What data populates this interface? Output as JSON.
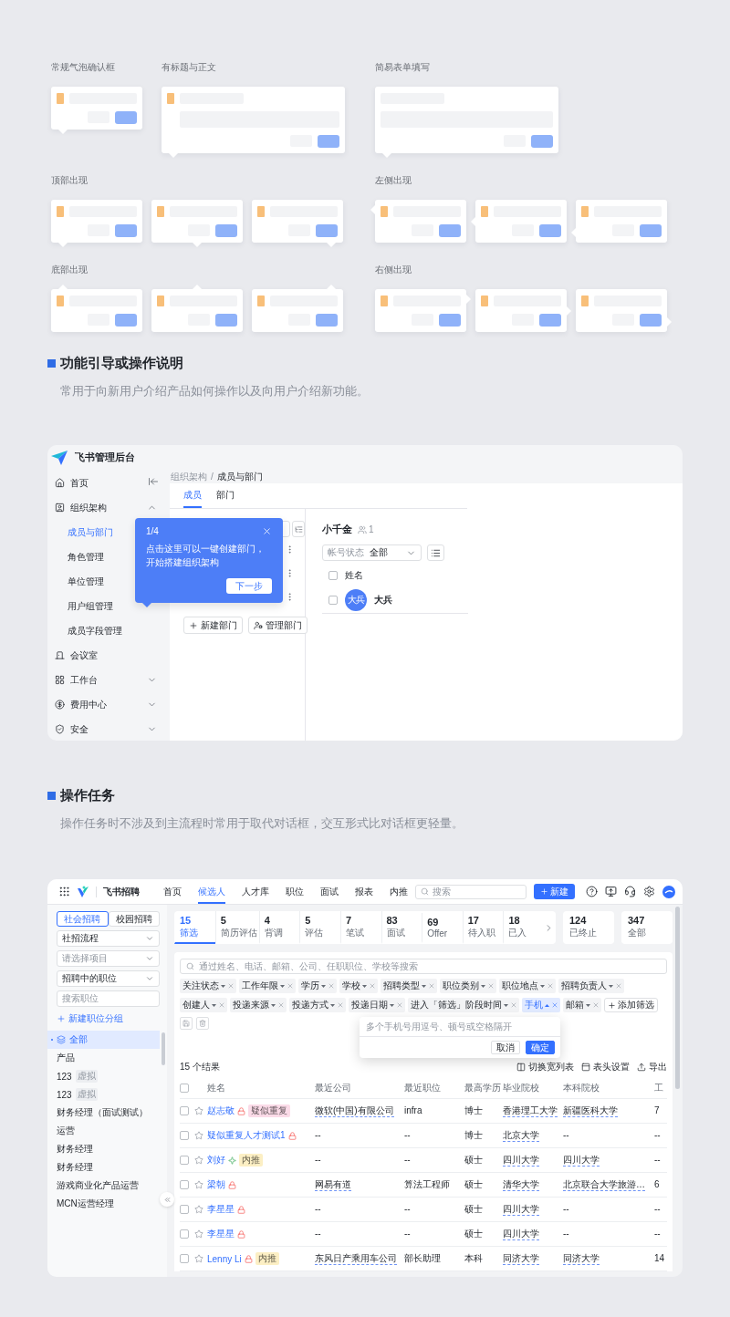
{
  "popover_demos": {
    "rows": [
      {
        "left": [
          {
            "label": "常规气泡确认框",
            "kind": "confirm",
            "cards": [
              {
                "kind": "bottom-start"
              }
            ]
          },
          {
            "label": "有标题与正文",
            "kind": "titled",
            "cards": [
              {
                "kind": "bottom-start"
              }
            ]
          }
        ],
        "right": [
          {
            "label": "简易表单填写",
            "kind": "form",
            "cards": [
              {
                "kind": "bottom-start"
              }
            ]
          }
        ]
      },
      {
        "left": [
          {
            "label": "顶部出现",
            "kind": "confirm",
            "cards": [
              {
                "kind": "bottom-start"
              },
              {
                "kind": "bottom-center"
              },
              {
                "kind": "bottom-end"
              }
            ]
          }
        ],
        "right": [
          {
            "label": "左侧出现",
            "kind": "confirm",
            "cards": [
              {
                "kind": "left-start"
              },
              {
                "kind": "left-center"
              },
              {
                "kind": "left-end"
              }
            ]
          }
        ]
      },
      {
        "left": [
          {
            "label": "底部出现",
            "kind": "confirm",
            "cards": [
              {
                "kind": "top-start"
              },
              {
                "kind": "top-center"
              },
              {
                "kind": "top-end"
              }
            ]
          }
        ],
        "right": [
          {
            "label": "右侧出现",
            "kind": "confirm",
            "cards": [
              {
                "kind": "right-start"
              },
              {
                "kind": "right-center"
              },
              {
                "kind": "right-end"
              }
            ]
          }
        ]
      }
    ]
  },
  "guide_section": {
    "title": "功能引导或操作说明",
    "description": "常用于向新用户介绍产品如何操作以及向用户介绍新功能。",
    "app": {
      "title": "飞书管理后台",
      "sidebar": [
        {
          "label": "首页",
          "selected": false
        },
        {
          "label": "组织架构",
          "selected": false,
          "expanded": true,
          "children": [
            {
              "label": "成员与部门",
              "selected": true
            },
            {
              "label": "角色管理",
              "selected": false
            },
            {
              "label": "单位管理",
              "selected": false
            },
            {
              "label": "用户组管理",
              "selected": false
            },
            {
              "label": "成员字段管理",
              "selected": false
            }
          ]
        },
        {
          "label": "会议室",
          "selected": false
        },
        {
          "label": "工作台",
          "selected": false,
          "expanded": false
        },
        {
          "label": "费用中心",
          "selected": false,
          "expanded": false
        },
        {
          "label": "安全",
          "selected": false,
          "expanded": false
        }
      ],
      "breadcrumb": [
        {
          "text": "组织架构",
          "kind": "link"
        },
        {
          "text": "/",
          "kind": "separator"
        },
        {
          "text": "成员与部门",
          "kind": "current"
        }
      ],
      "tabs": [
        {
          "label": "成员",
          "selected": true
        },
        {
          "label": "部门",
          "selected": false
        }
      ],
      "department_buttons": [
        "新建部门",
        "管理部门"
      ],
      "tour": {
        "step": "1/4",
        "text": "点击这里可以一键创建部门，开始搭建组织架构",
        "button": "下一步"
      },
      "members": {
        "title": "小千金",
        "count": "1",
        "filter": {
          "label": "帐号状态",
          "value": "全部"
        },
        "header": {
          "label": "姓名",
          "checked": false
        },
        "rows": [
          {
            "avatar": "大兵",
            "name": "大兵",
            "checked": false
          }
        ]
      }
    }
  },
  "task_section": {
    "title": "操作任务",
    "description": "操作任务时不涉及到主流程时常用于取代对话框，交互形式比对话框更轻量。",
    "app": {
      "brand": "飞书招聘",
      "nav": [
        {
          "label": "首页",
          "selected": false
        },
        {
          "label": "候选人",
          "selected": true
        },
        {
          "label": "人才库",
          "selected": false
        },
        {
          "label": "职位",
          "selected": false
        },
        {
          "label": "面试",
          "selected": false
        },
        {
          "label": "报表",
          "selected": false
        },
        {
          "label": "内推",
          "selected": false
        }
      ],
      "search_placeholder": "搜索",
      "new_button": "新建",
      "sidebar": {
        "segments": [
          {
            "label": "社会招聘",
            "selected": true
          },
          {
            "label": "校园招聘",
            "selected": false
          }
        ],
        "selects": [
          {
            "text": "社招流程",
            "kind": "value"
          },
          {
            "text": "请选择项目",
            "kind": "placeholder"
          },
          {
            "text": "招聘中的职位",
            "kind": "value"
          }
        ],
        "search_placeholder": "搜索职位",
        "add_group": "新建职位分组",
        "tree": [
          {
            "label": "全部",
            "selected": true
          },
          {
            "label": "产品",
            "selected": false
          },
          {
            "label": "123",
            "tag": "虚拟",
            "selected": false
          },
          {
            "label": "123",
            "tag": "虚拟",
            "selected": false
          },
          {
            "label": "财务经理（面试测试）",
            "selected": false
          },
          {
            "label": "运营",
            "selected": false
          },
          {
            "label": "财务经理",
            "selected": false
          },
          {
            "label": "财务经理",
            "selected": false
          },
          {
            "label": "游戏商业化产品运营",
            "selected": false
          },
          {
            "label": "MCN运营经理",
            "selected": false
          }
        ]
      },
      "stages": [
        {
          "count": "15",
          "label": "筛选",
          "selected": true
        },
        {
          "count": "5",
          "label": "简历评估",
          "selected": false
        },
        {
          "count": "4",
          "label": "背调",
          "selected": false
        },
        {
          "count": "5",
          "label": "评估",
          "selected": false
        },
        {
          "count": "7",
          "label": "笔试",
          "selected": false
        },
        {
          "count": "83",
          "label": "面试",
          "selected": false
        },
        {
          "count": "69",
          "label": "Offer",
          "selected": false
        },
        {
          "count": "17",
          "label": "待入职",
          "selected": false
        },
        {
          "count": "18",
          "label": "已入",
          "selected": false
        }
      ],
      "summary": [
        {
          "count": "124",
          "label": "已终止"
        },
        {
          "count": "347",
          "label": "全部"
        }
      ],
      "filter_search_placeholder": "通过姓名、电话、邮箱、公司、任职职位、学校等搜索",
      "chip_rows": [
        {
          "chips": [
            {
              "label": "关注状态",
              "active": false
            },
            {
              "label": "工作年限",
              "active": false
            },
            {
              "label": "学历",
              "active": false
            },
            {
              "label": "学校",
              "active": false
            },
            {
              "label": "招聘类型",
              "active": false
            },
            {
              "label": "职位类别",
              "active": false
            },
            {
              "label": "职位地点",
              "active": false
            },
            {
              "label": "招聘负责人",
              "active": false
            }
          ]
        },
        {
          "chips": [
            {
              "label": "创建人",
              "active": false
            },
            {
              "label": "投递来源",
              "active": false
            },
            {
              "label": "投递方式",
              "active": false
            },
            {
              "label": "投递日期",
              "active": false
            },
            {
              "label": "进入「筛选」阶段时间",
              "active": false
            },
            {
              "label": "手机",
              "active": true
            },
            {
              "label": "邮箱",
              "active": false
            }
          ],
          "add_button": "添加筛选"
        }
      ],
      "phone_popover": {
        "placeholder": "多个手机号用逗号、顿号或空格隔开",
        "cancel": "取消",
        "confirm": "确定"
      },
      "results": "15 个结果",
      "toolbar": [
        "切换宽列表",
        "表头设置",
        "导出"
      ],
      "table": {
        "header_checked": false,
        "name_header": "姓名",
        "columns": [
          "最近公司",
          "最近职位",
          "最高学历",
          "毕业院校",
          "本科院校",
          "工"
        ],
        "rows": [
          {
            "checked": false,
            "starred": false,
            "name": "赵志敬",
            "locked": true,
            "referred": false,
            "tag": {
              "text": "疑似重复",
              "color": "#fbdbe8"
            },
            "cells": [
              {
                "text": "微软(中国)有限公司",
                "link": true
              },
              {
                "text": "infra",
                "link": false
              },
              {
                "text": "博士",
                "link": false
              },
              {
                "text": "香港理工大学",
                "link": true
              },
              {
                "text": "新疆医科大学",
                "link": true
              },
              {
                "text": "7",
                "link": false
              }
            ]
          },
          {
            "checked": false,
            "starred": false,
            "name": "疑似重复人才测试1",
            "locked": true,
            "referred": false,
            "cells": [
              {
                "text": "--",
                "link": false
              },
              {
                "text": "--",
                "link": false
              },
              {
                "text": "博士",
                "link": false
              },
              {
                "text": "北京大学",
                "link": true
              },
              {
                "text": "--",
                "link": false
              },
              {
                "text": "--",
                "link": false
              }
            ]
          },
          {
            "checked": false,
            "starred": false,
            "name": "刘好",
            "locked": false,
            "referred": true,
            "tag": {
              "text": "内推",
              "color": "#fcefc4"
            },
            "cells": [
              {
                "text": "--",
                "link": false
              },
              {
                "text": "--",
                "link": false
              },
              {
                "text": "硕士",
                "link": false
              },
              {
                "text": "四川大学",
                "link": true
              },
              {
                "text": "四川大学",
                "link": true
              },
              {
                "text": "--",
                "link": false
              }
            ]
          },
          {
            "checked": false,
            "starred": false,
            "name": "梁朝",
            "locked": true,
            "referred": false,
            "cells": [
              {
                "text": "网易有道",
                "link": true
              },
              {
                "text": "算法工程师",
                "link": false
              },
              {
                "text": "硕士",
                "link": false
              },
              {
                "text": "清华大学",
                "link": true
              },
              {
                "text": "北京联合大学旅游…",
                "link": true
              },
              {
                "text": "6",
                "link": false
              }
            ]
          },
          {
            "checked": false,
            "starred": false,
            "name": "李星星",
            "locked": true,
            "referred": false,
            "cells": [
              {
                "text": "--",
                "link": false
              },
              {
                "text": "--",
                "link": false
              },
              {
                "text": "硕士",
                "link": false
              },
              {
                "text": "四川大学",
                "link": true
              },
              {
                "text": "--",
                "link": false
              },
              {
                "text": "--",
                "link": false
              }
            ]
          },
          {
            "checked": false,
            "starred": false,
            "name": "李星星",
            "locked": true,
            "referred": false,
            "cells": [
              {
                "text": "--",
                "link": false
              },
              {
                "text": "--",
                "link": false
              },
              {
                "text": "硕士",
                "link": false
              },
              {
                "text": "四川大学",
                "link": true
              },
              {
                "text": "--",
                "link": false
              },
              {
                "text": "--",
                "link": false
              }
            ]
          },
          {
            "checked": false,
            "starred": false,
            "name": "Lenny Li",
            "locked": true,
            "referred": false,
            "tag": {
              "text": "内推",
              "color": "#fcefc4"
            },
            "cells": [
              {
                "text": "东风日产乘用车公司",
                "link": true
              },
              {
                "text": "部长助理",
                "link": false
              },
              {
                "text": "本科",
                "link": false
              },
              {
                "text": "同济大学",
                "link": true
              },
              {
                "text": "同济大学",
                "link": true
              },
              {
                "text": "14",
                "link": false
              }
            ]
          }
        ]
      }
    }
  }
}
